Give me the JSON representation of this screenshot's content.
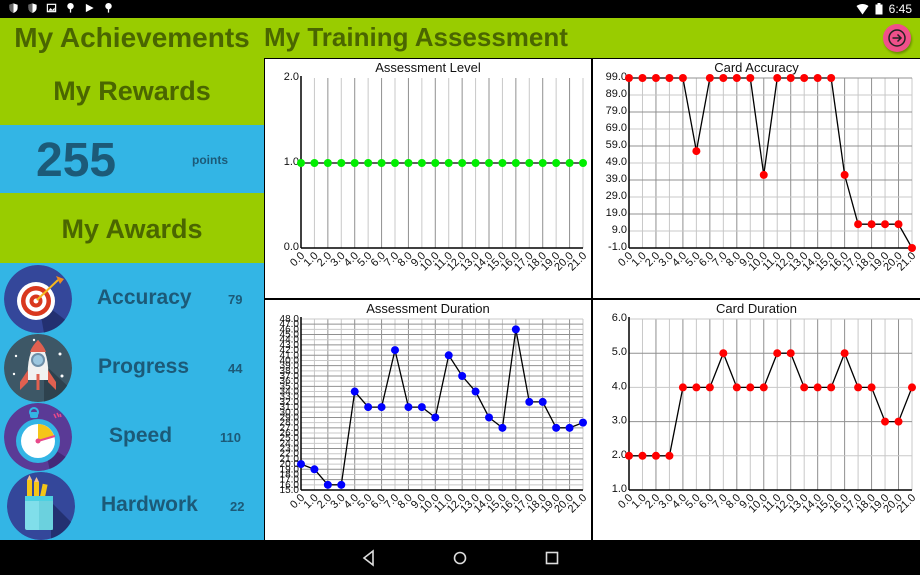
{
  "statusbar": {
    "left_icons": [
      "shield-icon",
      "shield-icon",
      "image-icon",
      "android-icon",
      "play-store-icon",
      "android-icon"
    ],
    "time": "6:45",
    "right_icons": [
      "wifi-icon",
      "battery-icon"
    ]
  },
  "left_panel": {
    "achievements_title": "My Achievements",
    "rewards_title": "My Rewards",
    "points_value": "255",
    "points_label": "points",
    "awards_title": "My Awards",
    "awards": [
      {
        "name": "Accuracy",
        "value": "79",
        "icon": "target-icon"
      },
      {
        "name": "Progress",
        "value": "44",
        "icon": "rocket-icon"
      },
      {
        "name": "Speed",
        "value": "110",
        "icon": "stopwatch-icon"
      },
      {
        "name": "Hardwork",
        "value": "22",
        "icon": "pencil-cup-icon"
      }
    ]
  },
  "main": {
    "title": "My Training Assessment",
    "next_button_icon": "arrow-right-circle-icon"
  },
  "colors": {
    "header_green": "#99cc00",
    "title_text": "#4a6600",
    "panel_blue": "#33b5e5",
    "panel_text": "#1c5a78",
    "fab_pink": "#f0508a",
    "green_points": "#00ee00",
    "red_points": "#ff0000",
    "blue_points": "#0000ff"
  },
  "chart_data": [
    {
      "type": "line",
      "title": "Assessment Level",
      "x": [
        0,
        1,
        2,
        3,
        4,
        5,
        6,
        7,
        8,
        9,
        10,
        11,
        12,
        13,
        14,
        15,
        16,
        17,
        18,
        19,
        20,
        21
      ],
      "x_tick_labels": [
        "0.0",
        "1.0",
        "2.0",
        "3.0",
        "4.0",
        "5.0",
        "6.0",
        "7.0",
        "8.0",
        "9.0",
        "10.0",
        "11.0",
        "12.0",
        "13.0",
        "14.0",
        "15.0",
        "16.0",
        "17.0",
        "18.0",
        "19.0",
        "20.0",
        "21.0"
      ],
      "values": [
        1,
        1,
        1,
        1,
        1,
        1,
        1,
        1,
        1,
        1,
        1,
        1,
        1,
        1,
        1,
        1,
        1,
        1,
        1,
        1,
        1,
        1
      ],
      "ylim": [
        0,
        2
      ],
      "y_ticks": [
        0,
        1,
        2
      ],
      "y_tick_labels": [
        "0.0",
        "1.0",
        "2.0"
      ],
      "point_color": "#00ee00",
      "grid": "vertical",
      "xlabel": "",
      "ylabel": ""
    },
    {
      "type": "line",
      "title": "Card Accuracy",
      "x": [
        0,
        1,
        2,
        3,
        4,
        5,
        6,
        7,
        8,
        9,
        10,
        11,
        12,
        13,
        14,
        15,
        16,
        17,
        18,
        19,
        20,
        21
      ],
      "x_tick_labels": [
        "0.0",
        "1.0",
        "2.0",
        "3.0",
        "4.0",
        "5.0",
        "6.0",
        "7.0",
        "8.0",
        "9.0",
        "10.0",
        "11.0",
        "12.0",
        "13.0",
        "14.0",
        "15.0",
        "16.0",
        "17.0",
        "18.0",
        "19.0",
        "20.0",
        "21.0"
      ],
      "values": [
        99,
        99,
        99,
        99,
        99,
        56,
        99,
        99,
        99,
        99,
        42,
        99,
        99,
        99,
        99,
        99,
        42,
        13,
        13,
        13,
        13,
        -1
      ],
      "ylim": [
        -1,
        99
      ],
      "y_ticks": [
        -1,
        9,
        19,
        29,
        39,
        49,
        59,
        69,
        79,
        89,
        99
      ],
      "y_tick_labels": [
        "-1.0",
        "9.0",
        "19.0",
        "29.0",
        "39.0",
        "49.0",
        "59.0",
        "69.0",
        "79.0",
        "89.0",
        "99.0"
      ],
      "point_color": "#ff0000",
      "grid": "both",
      "xlabel": "",
      "ylabel": ""
    },
    {
      "type": "line",
      "title": "Assessment Duration",
      "x": [
        0,
        1,
        2,
        3,
        4,
        5,
        6,
        7,
        8,
        9,
        10,
        11,
        12,
        13,
        14,
        15,
        16,
        17,
        18,
        19,
        20,
        21
      ],
      "x_tick_labels": [
        "0.0",
        "1.0",
        "2.0",
        "3.0",
        "4.0",
        "5.0",
        "6.0",
        "7.0",
        "8.0",
        "9.0",
        "10.0",
        "11.0",
        "12.0",
        "13.0",
        "14.0",
        "15.0",
        "16.0",
        "17.0",
        "18.0",
        "19.0",
        "20.0",
        "21.0"
      ],
      "values": [
        20,
        19,
        16,
        16,
        34,
        31,
        31,
        42,
        31,
        31,
        29,
        41,
        37,
        34,
        29,
        27,
        46,
        32,
        32,
        27,
        27,
        28
      ],
      "ylim": [
        15,
        48
      ],
      "y_ticks": [
        15,
        16,
        17,
        18,
        19,
        20,
        21,
        22,
        23,
        24,
        25,
        26,
        27,
        28,
        29,
        30,
        31,
        32,
        33,
        34,
        35,
        36,
        37,
        38,
        39,
        40,
        41,
        42,
        43,
        44,
        45,
        46,
        47,
        48
      ],
      "y_tick_labels": [
        "15.0",
        "16.0",
        "17.0",
        "18.0",
        "19.0",
        "20.0",
        "21.0",
        "22.0",
        "23.0",
        "24.0",
        "25.0",
        "26.0",
        "27.0",
        "28.0",
        "29.0",
        "30.0",
        "31.0",
        "32.0",
        "33.0",
        "34.0",
        "35.0",
        "36.0",
        "37.0",
        "38.0",
        "39.0",
        "40.0",
        "41.0",
        "42.0",
        "43.0",
        "44.0",
        "45.0",
        "46.0",
        "47.0",
        "48.0"
      ],
      "point_color": "#0000ff",
      "grid": "both",
      "xlabel": "",
      "ylabel": ""
    },
    {
      "type": "line",
      "title": "Card Duration",
      "x": [
        0,
        1,
        2,
        3,
        4,
        5,
        6,
        7,
        8,
        9,
        10,
        11,
        12,
        13,
        14,
        15,
        16,
        17,
        18,
        19,
        20,
        21
      ],
      "x_tick_labels": [
        "0.0",
        "1.0",
        "2.0",
        "3.0",
        "4.0",
        "5.0",
        "6.0",
        "7.0",
        "8.0",
        "9.0",
        "10.0",
        "11.0",
        "12.0",
        "13.0",
        "14.0",
        "15.0",
        "16.0",
        "17.0",
        "18.0",
        "19.0",
        "20.0",
        "21.0"
      ],
      "values": [
        2,
        2,
        2,
        2,
        4,
        4,
        4,
        5,
        4,
        4,
        4,
        5,
        5,
        4,
        4,
        4,
        5,
        4,
        4,
        3,
        3,
        4
      ],
      "ylim": [
        1,
        6
      ],
      "y_ticks": [
        1,
        2,
        3,
        4,
        5,
        6
      ],
      "y_tick_labels": [
        "1.0",
        "2.0",
        "3.0",
        "4.0",
        "5.0",
        "6.0"
      ],
      "point_color": "#ff0000",
      "grid": "both",
      "xlabel": "",
      "ylabel": ""
    }
  ],
  "navbar": {
    "buttons": [
      "back-icon",
      "home-icon",
      "recents-icon"
    ]
  }
}
